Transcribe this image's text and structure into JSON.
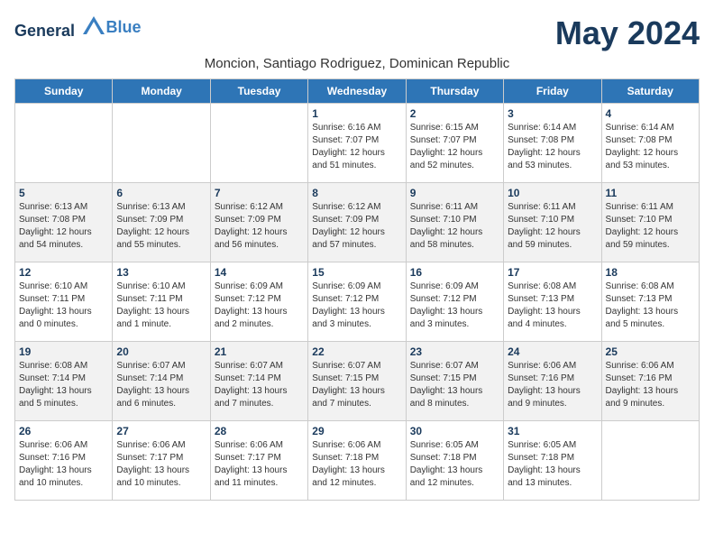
{
  "logo": {
    "general": "General",
    "blue": "Blue"
  },
  "title": "May 2024",
  "subtitle": "Moncion, Santiago Rodriguez, Dominican Republic",
  "days_of_week": [
    "Sunday",
    "Monday",
    "Tuesday",
    "Wednesday",
    "Thursday",
    "Friday",
    "Saturday"
  ],
  "weeks": [
    [
      {
        "day": "",
        "info": ""
      },
      {
        "day": "",
        "info": ""
      },
      {
        "day": "",
        "info": ""
      },
      {
        "day": "1",
        "info": "Sunrise: 6:16 AM\nSunset: 7:07 PM\nDaylight: 12 hours\nand 51 minutes."
      },
      {
        "day": "2",
        "info": "Sunrise: 6:15 AM\nSunset: 7:07 PM\nDaylight: 12 hours\nand 52 minutes."
      },
      {
        "day": "3",
        "info": "Sunrise: 6:14 AM\nSunset: 7:08 PM\nDaylight: 12 hours\nand 53 minutes."
      },
      {
        "day": "4",
        "info": "Sunrise: 6:14 AM\nSunset: 7:08 PM\nDaylight: 12 hours\nand 53 minutes."
      }
    ],
    [
      {
        "day": "5",
        "info": "Sunrise: 6:13 AM\nSunset: 7:08 PM\nDaylight: 12 hours\nand 54 minutes."
      },
      {
        "day": "6",
        "info": "Sunrise: 6:13 AM\nSunset: 7:09 PM\nDaylight: 12 hours\nand 55 minutes."
      },
      {
        "day": "7",
        "info": "Sunrise: 6:12 AM\nSunset: 7:09 PM\nDaylight: 12 hours\nand 56 minutes."
      },
      {
        "day": "8",
        "info": "Sunrise: 6:12 AM\nSunset: 7:09 PM\nDaylight: 12 hours\nand 57 minutes."
      },
      {
        "day": "9",
        "info": "Sunrise: 6:11 AM\nSunset: 7:10 PM\nDaylight: 12 hours\nand 58 minutes."
      },
      {
        "day": "10",
        "info": "Sunrise: 6:11 AM\nSunset: 7:10 PM\nDaylight: 12 hours\nand 59 minutes."
      },
      {
        "day": "11",
        "info": "Sunrise: 6:11 AM\nSunset: 7:10 PM\nDaylight: 12 hours\nand 59 minutes."
      }
    ],
    [
      {
        "day": "12",
        "info": "Sunrise: 6:10 AM\nSunset: 7:11 PM\nDaylight: 13 hours\nand 0 minutes."
      },
      {
        "day": "13",
        "info": "Sunrise: 6:10 AM\nSunset: 7:11 PM\nDaylight: 13 hours\nand 1 minute."
      },
      {
        "day": "14",
        "info": "Sunrise: 6:09 AM\nSunset: 7:12 PM\nDaylight: 13 hours\nand 2 minutes."
      },
      {
        "day": "15",
        "info": "Sunrise: 6:09 AM\nSunset: 7:12 PM\nDaylight: 13 hours\nand 3 minutes."
      },
      {
        "day": "16",
        "info": "Sunrise: 6:09 AM\nSunset: 7:12 PM\nDaylight: 13 hours\nand 3 minutes."
      },
      {
        "day": "17",
        "info": "Sunrise: 6:08 AM\nSunset: 7:13 PM\nDaylight: 13 hours\nand 4 minutes."
      },
      {
        "day": "18",
        "info": "Sunrise: 6:08 AM\nSunset: 7:13 PM\nDaylight: 13 hours\nand 5 minutes."
      }
    ],
    [
      {
        "day": "19",
        "info": "Sunrise: 6:08 AM\nSunset: 7:14 PM\nDaylight: 13 hours\nand 5 minutes."
      },
      {
        "day": "20",
        "info": "Sunrise: 6:07 AM\nSunset: 7:14 PM\nDaylight: 13 hours\nand 6 minutes."
      },
      {
        "day": "21",
        "info": "Sunrise: 6:07 AM\nSunset: 7:14 PM\nDaylight: 13 hours\nand 7 minutes."
      },
      {
        "day": "22",
        "info": "Sunrise: 6:07 AM\nSunset: 7:15 PM\nDaylight: 13 hours\nand 7 minutes."
      },
      {
        "day": "23",
        "info": "Sunrise: 6:07 AM\nSunset: 7:15 PM\nDaylight: 13 hours\nand 8 minutes."
      },
      {
        "day": "24",
        "info": "Sunrise: 6:06 AM\nSunset: 7:16 PM\nDaylight: 13 hours\nand 9 minutes."
      },
      {
        "day": "25",
        "info": "Sunrise: 6:06 AM\nSunset: 7:16 PM\nDaylight: 13 hours\nand 9 minutes."
      }
    ],
    [
      {
        "day": "26",
        "info": "Sunrise: 6:06 AM\nSunset: 7:16 PM\nDaylight: 13 hours\nand 10 minutes."
      },
      {
        "day": "27",
        "info": "Sunrise: 6:06 AM\nSunset: 7:17 PM\nDaylight: 13 hours\nand 10 minutes."
      },
      {
        "day": "28",
        "info": "Sunrise: 6:06 AM\nSunset: 7:17 PM\nDaylight: 13 hours\nand 11 minutes."
      },
      {
        "day": "29",
        "info": "Sunrise: 6:06 AM\nSunset: 7:18 PM\nDaylight: 13 hours\nand 12 minutes."
      },
      {
        "day": "30",
        "info": "Sunrise: 6:05 AM\nSunset: 7:18 PM\nDaylight: 13 hours\nand 12 minutes."
      },
      {
        "day": "31",
        "info": "Sunrise: 6:05 AM\nSunset: 7:18 PM\nDaylight: 13 hours\nand 13 minutes."
      },
      {
        "day": "",
        "info": ""
      }
    ]
  ]
}
